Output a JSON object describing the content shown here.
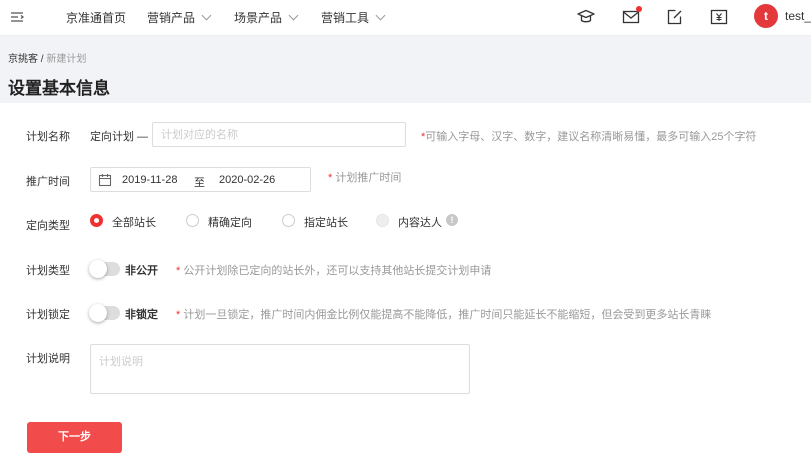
{
  "nav": {
    "items": [
      {
        "label": "京准通首页",
        "has_dropdown": false
      },
      {
        "label": "营销产品",
        "has_dropdown": true
      },
      {
        "label": "场景产品",
        "has_dropdown": true
      },
      {
        "label": "营销工具",
        "has_dropdown": true
      }
    ],
    "icons": [
      "graduation-cap-icon",
      "mail-icon",
      "edit-note-icon",
      "yuan-wallet-icon"
    ],
    "avatar_letter": "t",
    "username": "test_"
  },
  "breadcrumb": {
    "root": "京挑客",
    "separator": " / ",
    "current": "新建计划"
  },
  "page_title": "设置基本信息",
  "form": {
    "plan_name": {
      "label": "计划名称",
      "prefix": "定向计划 —",
      "placeholder": "计划对应的名称",
      "hint_star": "*",
      "hint": "可输入字母、汉字、数字，建议名称清晰易懂，最多可输入25个字符"
    },
    "promo_time": {
      "label": "推广时间",
      "start": "2019-11-28",
      "separator": "至",
      "end": "2020-02-26",
      "hint_star": "*",
      "hint": " 计划推广时间"
    },
    "target_type": {
      "label": "定向类型",
      "options": [
        {
          "label": "全部站长",
          "state": "checked"
        },
        {
          "label": "精确定向",
          "state": "unchecked"
        },
        {
          "label": "指定站长",
          "state": "unchecked"
        },
        {
          "label": "内容达人",
          "state": "disabled"
        }
      ],
      "info_icon": "info-icon"
    },
    "plan_type": {
      "label": "计划类型",
      "switch_text": "非公开",
      "switch_on": false,
      "hint_star": "*",
      "hint": " 公开计划除已定向的站长外，还可以支持其他站长提交计划申请"
    },
    "plan_lock": {
      "label": "计划锁定",
      "switch_text": "非锁定",
      "switch_on": false,
      "hint_star": "*",
      "hint": " 计划一旦锁定，推广时间内佣金比例仅能提高不能降低，推广时间只能延长不能缩短，但会受到更多站长青睐"
    },
    "plan_desc": {
      "label": "计划说明",
      "placeholder": "计划说明"
    }
  },
  "next_button": "下一步",
  "colors": {
    "accent": "#f23030",
    "button": "#f24b4b",
    "page_bg": "#f2f3f7"
  }
}
